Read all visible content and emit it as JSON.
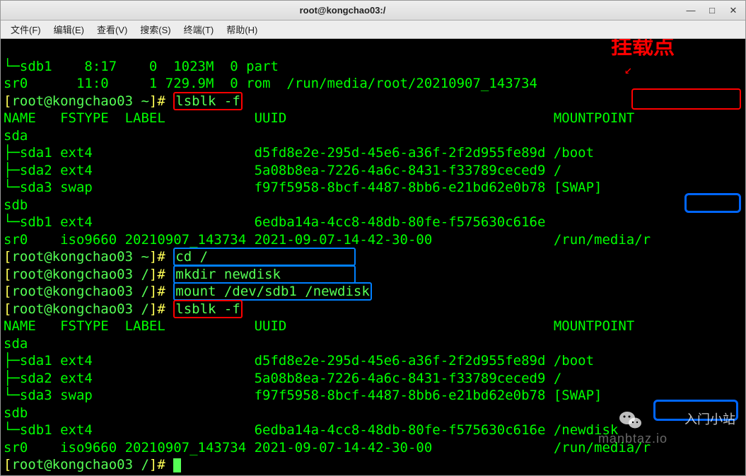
{
  "window": {
    "title": "root@kongchao03:/",
    "controls": {
      "min": "—",
      "max": "□",
      "close": "✕"
    }
  },
  "menus": {
    "file": "文件(F)",
    "edit": "编辑(E)",
    "view": "查看(V)",
    "search": "搜索(S)",
    "terminal": "终端(T)",
    "help": "帮助(H)"
  },
  "annotation": {
    "mount_label": "挂载点"
  },
  "term": {
    "l1": "└─sdb1    8:17    0  1023M  0 part ",
    "l2": "sr0      11:0     1 729.9M  0 rom  /run/media/root/20210907_143734",
    "p1_open": "[",
    "p1_user": "root@kongchao03 ~",
    "p1_close": "]#",
    "p1_cmd": "lsblk -f",
    "h1": "NAME   FSTYPE  LABEL           UUID                                 MOUNTPOINT",
    "l3": "sda                                                                 ",
    "l4": "├─sda1 ext4                    d5fd8e2e-295d-45e6-a36f-2f2d955fe89d /boot",
    "l5": "├─sda2 ext4                    5a08b8ea-7226-4a6c-8431-f33789ceced9 /",
    "l6": "└─sda3 swap                    f97f5958-8bcf-4487-8bb6-e21bd62e0b78 [SWAP]",
    "l7": "sdb                                                                 ",
    "l8": "└─sdb1 ext4                    6edba14a-4cc8-48db-80fe-f575630c616e ",
    "l9": "sr0    iso9660 20210907_143734 2021-09-07-14-42-30-00               /run/media/r",
    "p2_open": "[",
    "p2_user": "root@kongchao03 ~",
    "p2_close": "]#",
    "p2_cmd": "cd /                  ",
    "p3_open": "[",
    "p3_user": "root@kongchao03 /",
    "p3_close": "]#",
    "p3_cmd": "mkdir newdisk         ",
    "p4_open": "[",
    "p4_user": "root@kongchao03 /",
    "p4_close": "]#",
    "p4_cmd": "mount /dev/sdb1 /newdisk",
    "p5_open": "[",
    "p5_user": "root@kongchao03 /",
    "p5_close": "]#",
    "p5_cmd": "lsblk -f",
    "h2": "NAME   FSTYPE  LABEL           UUID                                 MOUNTPOINT",
    "l10": "sda                                                                 ",
    "l11": "├─sda1 ext4                    d5fd8e2e-295d-45e6-a36f-2f2d955fe89d /boot",
    "l12": "├─sda2 ext4                    5a08b8ea-7226-4a6c-8431-f33789ceced9 /",
    "l13": "└─sda3 swap                    f97f5958-8bcf-4487-8bb6-e21bd62e0b78 [SWAP]",
    "l14": "sdb                                                                 ",
    "l15": "└─sdb1 ext4                    6edba14a-4cc8-48db-80fe-f575630c616e /newdisk",
    "l16": "sr0    iso9660 20210907_143734 2021-09-07-14-42-30-00               /run/media/r",
    "p6_open": "[",
    "p6_user": "root@kongchao03 /",
    "p6_close": "]#"
  },
  "watermark": {
    "center": "manbtaz.io",
    "corner": "入门小站"
  }
}
